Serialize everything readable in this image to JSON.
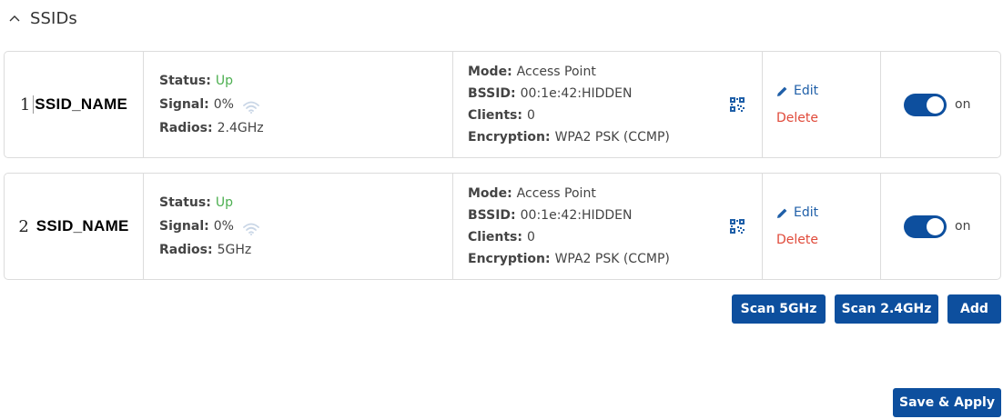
{
  "section": {
    "title": "SSIDs",
    "collapse_icon": "chevron-up-icon"
  },
  "ssids": [
    {
      "index": "1",
      "name": "SSID_NAME",
      "status_label": "Status:",
      "status": "Up",
      "signal_label": "Signal:",
      "signal": "0%",
      "radios_label": "Radios:",
      "radios": "2.4GHz",
      "mode_label": "Mode:",
      "mode": "Access Point",
      "bssid_label": "BSSID:",
      "bssid": "00:1e:42:HIDDEN",
      "clients_label": "Clients:",
      "clients": "0",
      "encryption_label": "Encryption:",
      "encryption": "WPA2 PSK (CCMP)",
      "edit_label": "Edit",
      "delete_label": "Delete",
      "toggle_label": "on"
    },
    {
      "index": "2",
      "name": "SSID_NAME",
      "status_label": "Status:",
      "status": "Up",
      "signal_label": "Signal:",
      "signal": "0%",
      "radios_label": "Radios:",
      "radios": "5GHz",
      "mode_label": "Mode:",
      "mode": "Access Point",
      "bssid_label": "BSSID:",
      "bssid": "00:1e:42:HIDDEN",
      "clients_label": "Clients:",
      "clients": "0",
      "encryption_label": "Encryption:",
      "encryption": "WPA2 PSK (CCMP)",
      "edit_label": "Edit",
      "delete_label": "Delete",
      "toggle_label": "on"
    }
  ],
  "buttons": {
    "scan_5ghz": "Scan 5GHz",
    "scan_24ghz": "Scan 2.4GHz",
    "add": "Add",
    "save_apply": "Save & Apply"
  },
  "colors": {
    "primary": "#0d4f9e",
    "status_up": "#4caf50",
    "delete": "#e04a3a",
    "link": "#1f5fa8"
  }
}
